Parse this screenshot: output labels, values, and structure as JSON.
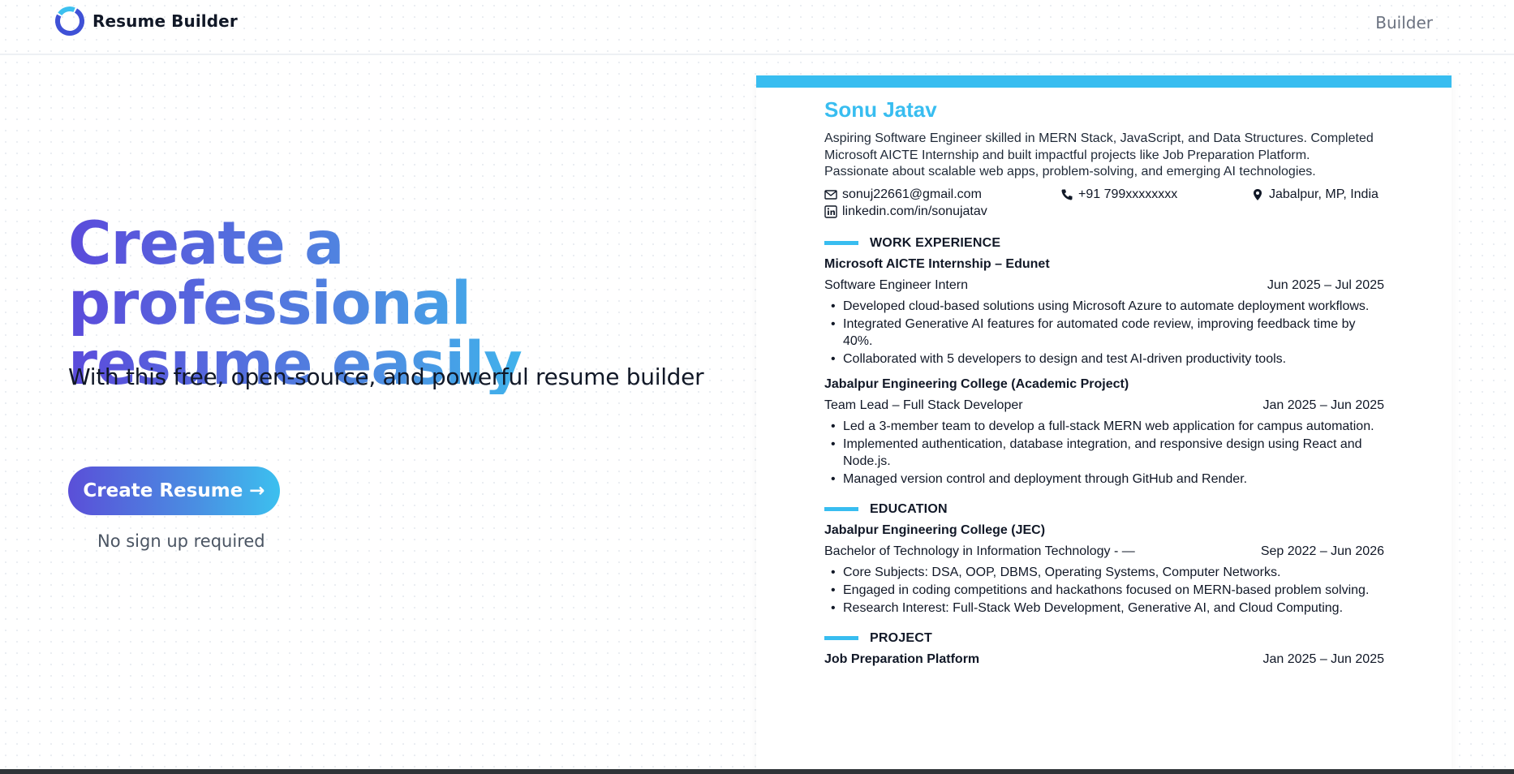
{
  "header": {
    "app_name": "Resume Builder",
    "nav_builder": "Builder"
  },
  "hero": {
    "title_line1": "Create a professional",
    "title_line2": "resume easily",
    "subtitle": "With this free, open-source, and powerful resume builder",
    "cta_label": "Create Resume →",
    "cta_note": "No sign up required"
  },
  "colors": {
    "accent": "#38bdf0",
    "gradient_start": "#5b4bdb",
    "gradient_end": "#3cc0ef"
  },
  "resume": {
    "name": "Sonu Jatav",
    "summary": "Aspiring Software Engineer skilled in MERN Stack, JavaScript, and Data Structures. Completed Microsoft AICTE Internship and built impactful projects like Job Preparation Platform. Passionate about scalable web apps, problem-solving, and emerging AI technologies.",
    "contact": {
      "email": "sonuj22661@gmail.com",
      "phone": "+91 799xxxxxxxx",
      "location": "Jabalpur, MP, India",
      "linkedin": "linkedin.com/in/sonujatav"
    },
    "work_title": "WORK EXPERIENCE",
    "work": [
      {
        "org": "Microsoft AICTE Internship – Edunet",
        "role": "Software Engineer Intern",
        "dates": "Jun 2025 – Jul 2025",
        "bullets": [
          "Developed cloud-based solutions using Microsoft Azure to automate deployment workflows.",
          "Integrated Generative AI features for automated code review, improving feedback time by 40%.",
          "Collaborated with 5 developers to design and test AI-driven productivity tools."
        ]
      },
      {
        "org": "Jabalpur Engineering College (Academic Project)",
        "role": "Team Lead – Full Stack Developer",
        "dates": "Jan 2025 – Jun 2025",
        "bullets": [
          "Led a 3-member team to develop a full-stack MERN web application for campus automation.",
          "Implemented authentication, database integration, and responsive design using React and Node.js.",
          "Managed version control and deployment through GitHub and Render."
        ]
      }
    ],
    "education_title": "EDUCATION",
    "education": {
      "org": "Jabalpur Engineering College (JEC)",
      "degree": "Bachelor of Technology in Information Technology - —",
      "dates": "Sep 2022 – Jun 2026",
      "bullets": [
        "Core Subjects: DSA, OOP, DBMS, Operating Systems, Computer Networks.",
        "Engaged in coding competitions and hackathons focused on MERN-based problem solving.",
        "Research Interest: Full-Stack Web Development, Generative AI, and Cloud Computing."
      ]
    },
    "project_title": "PROJECT",
    "project": {
      "name": "Job Preparation Platform",
      "dates": "Jan 2025 – Jun 2025"
    }
  }
}
